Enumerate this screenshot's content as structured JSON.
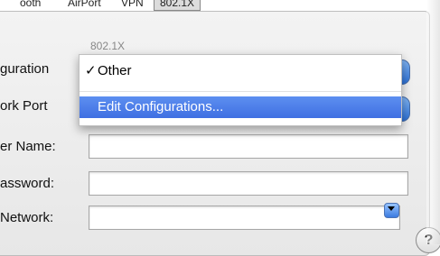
{
  "tabs": [
    {
      "label": "ooth"
    },
    {
      "label": "AirPort"
    },
    {
      "label": "VPN"
    },
    {
      "label": "802.1X"
    }
  ],
  "section_label": "802.1X",
  "labels": {
    "configuration": "guration",
    "network_port": "ork Port",
    "user_name": "er Name:",
    "password": "assword:",
    "network": "Network:"
  },
  "popup_menu": {
    "items": [
      {
        "label": "Other",
        "checked": true
      },
      {
        "label": "Edit Configurations...",
        "highlighted": true
      }
    ],
    "check": "✓"
  },
  "help_icon": "?"
}
